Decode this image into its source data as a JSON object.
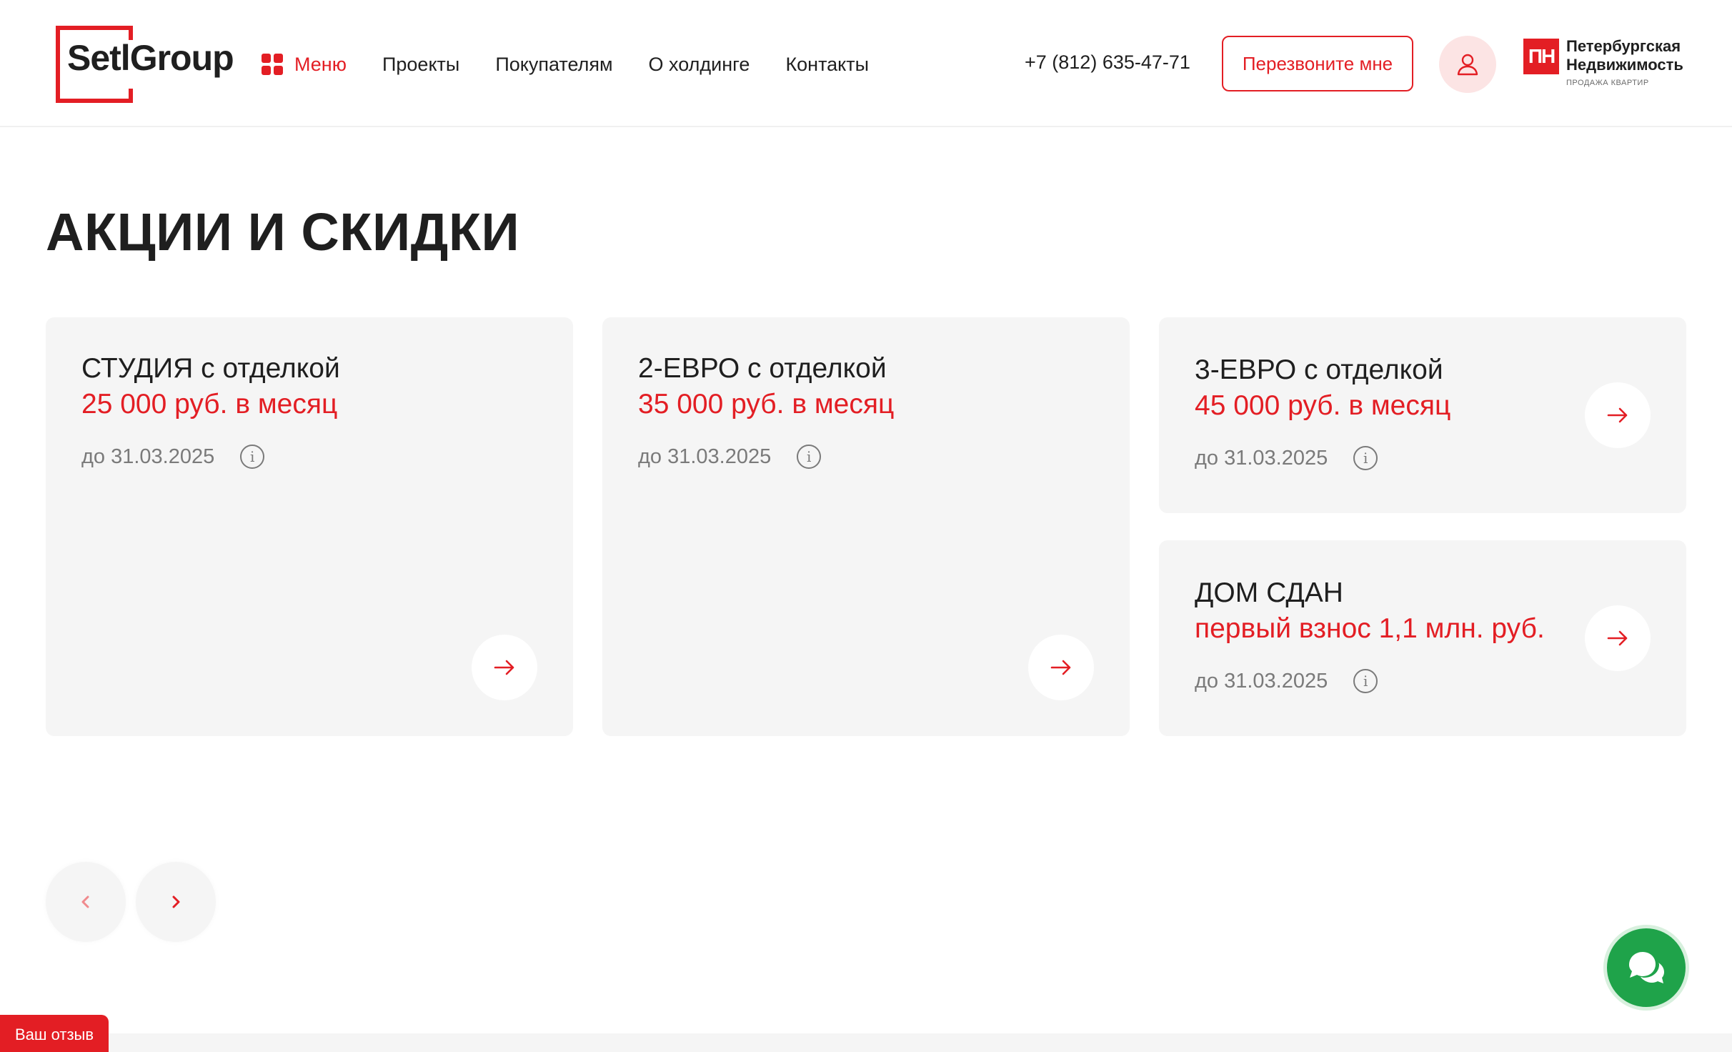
{
  "header": {
    "logo_text": "SetlGroup",
    "menu_label": "Меню",
    "nav": [
      "Проекты",
      "Покупателям",
      "О холдинге",
      "Контакты"
    ],
    "phone": "+7 (812) 635-47-71",
    "callback_label": "Перезвоните мне",
    "partner": {
      "mark": "ПН",
      "name_line1": "Петербургская",
      "name_line2": "Недвижимость",
      "subtitle": "ПРОДАЖА КВАРТИР"
    }
  },
  "page": {
    "title": "АКЦИИ И СКИДКИ"
  },
  "promos": [
    {
      "title": "СТУДИЯ с отделкой",
      "price": "25 000 руб. в месяц",
      "date": "до 31.03.2025"
    },
    {
      "title": "2-ЕВРО с отделкой",
      "price": "35 000 руб. в месяц",
      "date": "до 31.03.2025"
    },
    {
      "title": "3-ЕВРО с отделкой",
      "price": "45 000 руб. в месяц",
      "date": "до 31.03.2025"
    },
    {
      "title": "ДОМ СДАН",
      "price": "первый взнос 1,1 млн. руб.",
      "date": "до 31.03.2025"
    }
  ],
  "info_glyph": "i",
  "feedback_label": "Ваш отзыв",
  "colors": {
    "accent": "#e31e24",
    "card_bg": "#f5f5f5",
    "chat_green": "#1fa34a",
    "text": "#1f1f1f",
    "muted": "#7a7a7a"
  },
  "icons": {
    "menu": "grid-icon",
    "account": "user-icon",
    "card_action": "arrow-right-icon",
    "slider_prev": "chevron-left-icon",
    "slider_next": "chevron-right-icon",
    "chat": "chat-bubbles-icon",
    "info": "info-icon"
  }
}
